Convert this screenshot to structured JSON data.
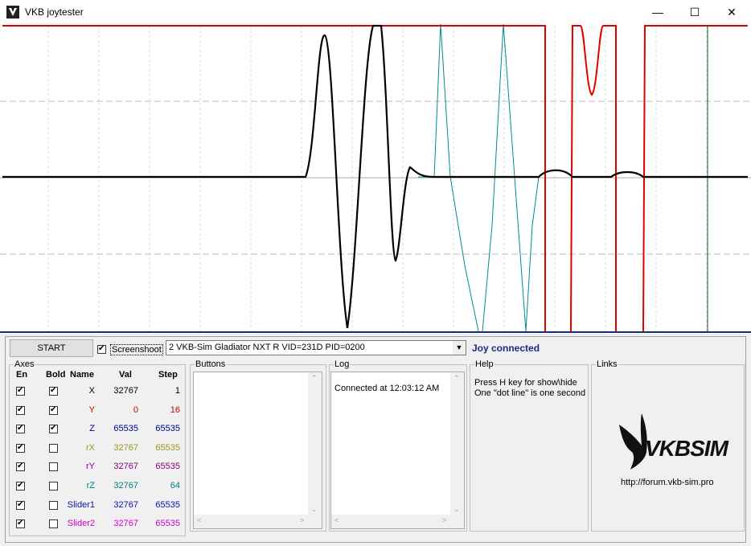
{
  "window": {
    "title": "VKB joytester"
  },
  "controls": {
    "start_label": "START",
    "screenshot_label": "Screenshoot",
    "device_selected": "2  VKB-Sim Gladiator NXT R   VID=231D PID=0200",
    "status": "Joy connected"
  },
  "axes": {
    "group_label": "Axes",
    "headers": {
      "en": "En",
      "bold": "Bold",
      "name": "Name",
      "val": "Val",
      "step": "Step"
    },
    "rows": [
      {
        "name": "X",
        "val": "32767",
        "step": "1",
        "color": "#000000",
        "en": true,
        "bold": true
      },
      {
        "name": "Y",
        "val": "0",
        "step": "16",
        "color": "#d40000",
        "en": true,
        "bold": true
      },
      {
        "name": "Z",
        "val": "65535",
        "step": "65535",
        "color": "#00008b",
        "en": true,
        "bold": true
      },
      {
        "name": "rX",
        "val": "32767",
        "step": "65535",
        "color": "#9a9a20",
        "en": true,
        "bold": false
      },
      {
        "name": "rY",
        "val": "32767",
        "step": "65535",
        "color": "#8b008b",
        "en": true,
        "bold": false
      },
      {
        "name": "rZ",
        "val": "32767",
        "step": "64",
        "color": "#008080",
        "en": true,
        "bold": false
      },
      {
        "name": "Slider1",
        "val": "32767",
        "step": "65535",
        "color": "#1010b0",
        "en": true,
        "bold": false
      },
      {
        "name": "Slider2",
        "val": "32767",
        "step": "65535",
        "color": "#d000d0",
        "en": true,
        "bold": false
      }
    ]
  },
  "buttons_group": {
    "label": "Buttons"
  },
  "log": {
    "label": "Log",
    "lines": [
      "Connected at 12:03:12 AM"
    ]
  },
  "help": {
    "label": "Help",
    "line1": "Press H key for show\\hide",
    "line2": "One \"dot line\" is one second"
  },
  "links": {
    "label": "Links",
    "logo_text": "VKBSIM",
    "url": "http://forum.vkb-sim.pro"
  },
  "colors": {
    "graph_red": "#e00000",
    "graph_teal": "#008b8b",
    "graph_green": "#006400"
  }
}
